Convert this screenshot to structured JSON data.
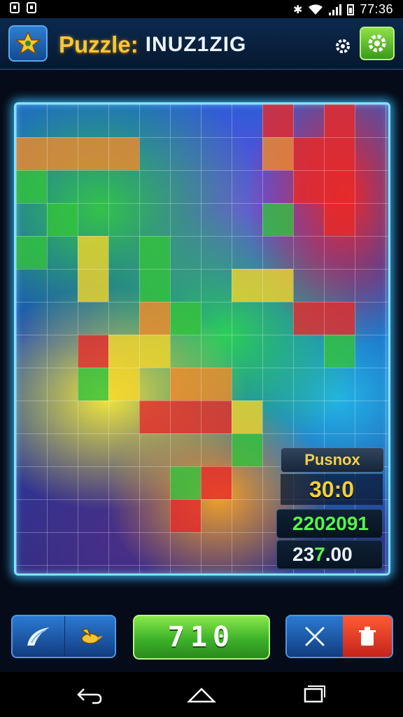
{
  "status_bar": {
    "time": "77:36",
    "icons": [
      "notification-icon",
      "notification-icon",
      "bluetooth-icon",
      "wifi-icon",
      "signal-icon",
      "battery-icon"
    ]
  },
  "header": {
    "logo_icon": "star-dragon-logo",
    "title_part1": "Puzzle:",
    "title_part2": "INUZ1ZIG",
    "settings_icon": "gear-icon",
    "settings_button_color": "#5cc22a"
  },
  "board": {
    "grid_columns": 12,
    "grid_rows": 14,
    "accent_color": "#7fe3ff"
  },
  "score_panel": {
    "label": "Pusnox",
    "score": "30:0",
    "line1": "2202091",
    "line2_prefix": "23",
    "line2_highlight": "7",
    "line2_suffix": ".00"
  },
  "controls": {
    "left_icons": [
      "swoosh-icon",
      "bird-icon"
    ],
    "counter": "710",
    "right_icons": [
      "close-icon",
      "trash-icon"
    ]
  },
  "navbar": {
    "icons": [
      "back-icon",
      "home-icon",
      "recents-icon"
    ]
  }
}
